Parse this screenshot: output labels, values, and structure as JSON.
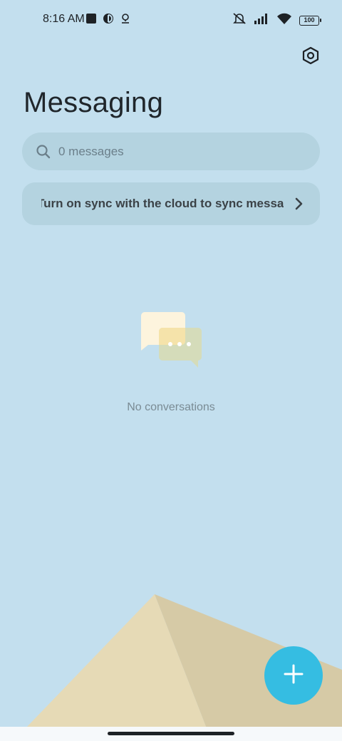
{
  "status_bar": {
    "time": "8:16 AM",
    "battery": "100",
    "icons": [
      "notification-square-icon",
      "app-notification-icon",
      "location-pin-icon",
      "mute-icon",
      "signal-icon",
      "wifi-icon",
      "battery-icon"
    ]
  },
  "header": {
    "title": "Messaging",
    "settings_icon": "settings-hexagon-icon"
  },
  "search": {
    "placeholder": "0 messages"
  },
  "sync_banner": {
    "label": "Turn on sync with the cloud to sync messages"
  },
  "empty_state": {
    "text": "No conversations",
    "icon": "chat-bubbles-illustration"
  },
  "fab": {
    "icon": "plus-icon"
  },
  "colors": {
    "background": "#c3dfee",
    "surface": "#b4d3e0",
    "accent": "#35bde2",
    "pyramid_light": "#e6dab6",
    "pyramid_dark": "#d6caa6"
  }
}
